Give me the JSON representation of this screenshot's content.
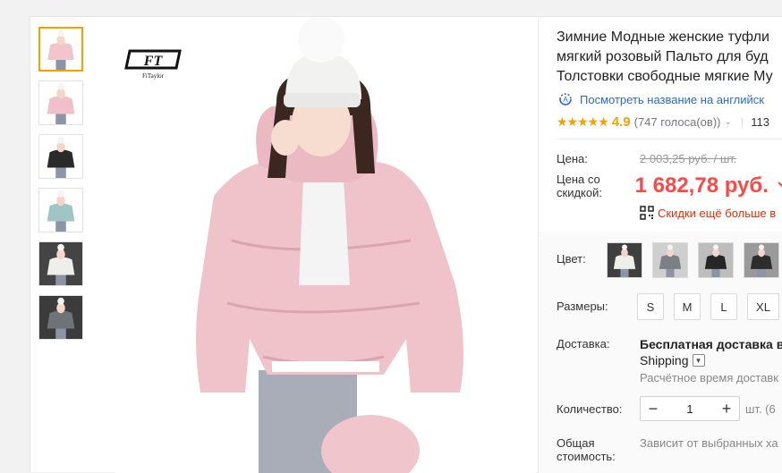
{
  "thumbnails": [
    {
      "name": "thumb-1",
      "coat": "#f2c5cd",
      "bg": "#ffffff",
      "active": true
    },
    {
      "name": "thumb-2",
      "coat": "#f0bfc9",
      "bg": "#ffffff",
      "active": false
    },
    {
      "name": "thumb-3",
      "coat": "#2a2a2a",
      "bg": "#ffffff",
      "active": false
    },
    {
      "name": "thumb-4",
      "coat": "#9fc6c4",
      "bg": "#ffffff",
      "active": false
    },
    {
      "name": "thumb-5",
      "coat": "#eeeeea",
      "bg": "#444444",
      "active": false
    },
    {
      "name": "thumb-6",
      "coat": "#6e7378",
      "bg": "#3b3b3b",
      "active": false
    }
  ],
  "brand": {
    "logo_text": "FT",
    "logo_sub": "FiTaylor"
  },
  "product": {
    "title_lines": [
      "Зимние Модные женские туфли",
      "мягкий розовый Пальто для буд",
      "Толстовки свободные мягкие Му"
    ],
    "translate_link": "Посмотреть название на английск",
    "rating_value": "4.9",
    "votes": "(747 голоса(ов))",
    "orders_count": "113",
    "stars": "★★★★★"
  },
  "price": {
    "original_label": "Цена:",
    "original_value": "2 003,25 руб. / шт.",
    "discount_label_1": "Цена со",
    "discount_label_2": "скидкой:",
    "discount_value": "1 682,78 руб.",
    "promo_text": "Скидки ещё больше в"
  },
  "options": {
    "color_label": "Цвет:",
    "color_swatches": [
      {
        "coat": "#eeeeea",
        "bg": "#3f3f3f"
      },
      {
        "coat": "#7b8085",
        "bg": "#cfcfcf"
      },
      {
        "coat": "#262626",
        "bg": "#bdbdbd"
      },
      {
        "coat": "#2d2d2d",
        "bg": "#9a9a9a"
      }
    ],
    "size_label": "Размеры:",
    "sizes": [
      "S",
      "M",
      "L",
      "XL"
    ],
    "shipping_label": "Доставка:",
    "shipping_main": "Бесплатная доставка в",
    "shipping_method": "Shipping",
    "shipping_note": "Расчётное время доставк",
    "quantity_label": "Количество:",
    "quantity_value": "1",
    "quantity_unit": "шт. (6",
    "total_label_1": "Общая",
    "total_label_2": "стоимость:",
    "total_note": "Зависит от выбранных ха"
  },
  "colors": {
    "accent_orange": "#f6a100",
    "price_red": "#ff4747",
    "link_blue": "#2a6bc6",
    "coat_pink": "#f2c5cd"
  }
}
